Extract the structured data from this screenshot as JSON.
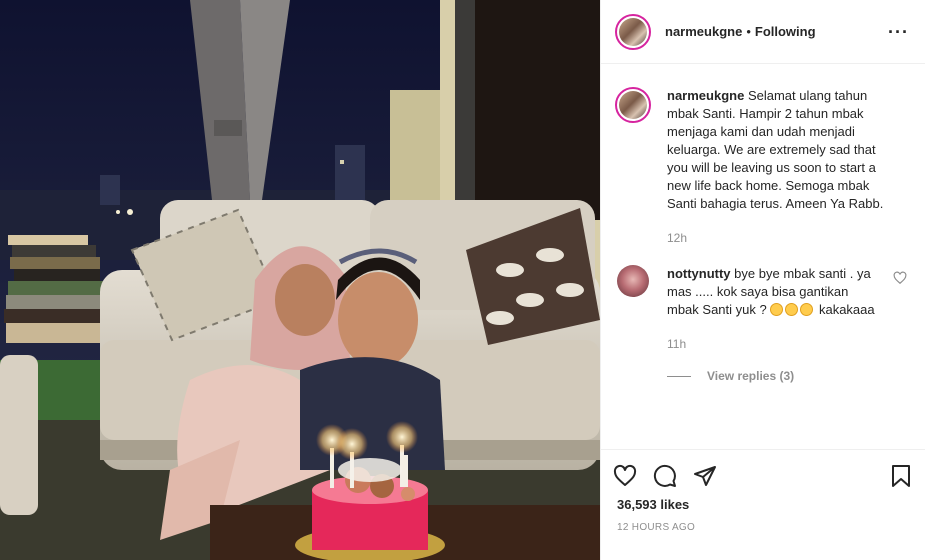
{
  "post": {
    "author": "narmeukgne",
    "follow_status": "Following",
    "separator": "•",
    "caption": "Selamat ulang tahun mbak Santi. Hampir 2 tahun mbak menjaga kami dan udah menjadi keluarga. We are extremely sad that you will be leaving us soon to start a new life back home. Semoga mbak Santi bahagia terus. Ameen Ya Rabb.",
    "caption_age": "12h",
    "likes": "36,593 likes",
    "posted": "12 HOURS AGO",
    "more_icon": "more-dots-icon"
  },
  "comments": [
    {
      "user": "nottynutty",
      "text": "bye bye mbak santi . ya mas ..... kok saya bisa gantikan mbak Santi yuk ?",
      "text_after_emoji": "kakakaaa",
      "emojis": [
        "tongue-face-emoji",
        "rofl-emoji",
        "rofl-emoji"
      ],
      "age": "11h",
      "view_replies": "View replies (3)"
    }
  ],
  "actions": {
    "icons": [
      "heart-icon",
      "comment-icon",
      "share-icon",
      "bookmark-icon"
    ]
  },
  "photo": {
    "description_icon": "photo-birthday-cake"
  },
  "colors": {
    "story_ring": "#d6249f",
    "meta_gray": "#8e8e8e",
    "border": "#efefef"
  }
}
